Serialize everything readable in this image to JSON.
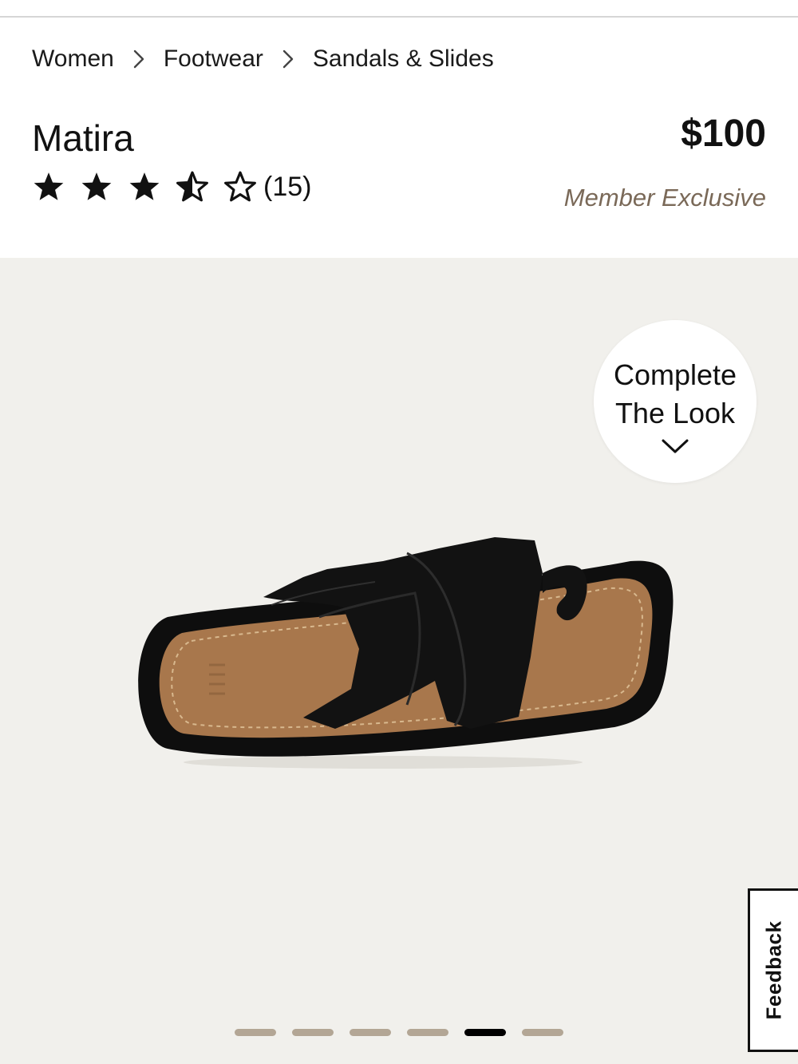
{
  "breadcrumb": {
    "items": [
      "Women",
      "Footwear",
      "Sandals & Slides"
    ]
  },
  "product": {
    "name": "Matira",
    "rating": 3.5,
    "rating_max": 5,
    "review_count": "(15)",
    "price": "$100",
    "badge": "Member Exclusive"
  },
  "gallery": {
    "complete_look_line1": "Complete",
    "complete_look_line2": "The Look",
    "active_slide": 5,
    "total_slides": 6
  },
  "feedback": {
    "label": "Feedback"
  },
  "icons": {
    "breadcrumb_separator": "chevron-right-icon",
    "complete_look": "chevron-down-icon",
    "rating": [
      "star-filled-icon",
      "star-filled-icon",
      "star-filled-icon",
      "star-half-icon",
      "star-outline-icon"
    ]
  },
  "colors": {
    "member_exclusive": "#7a6958",
    "gallery_background": "#f1f0ec",
    "dot_inactive": "#b3a695",
    "dot_active": "#000000"
  }
}
